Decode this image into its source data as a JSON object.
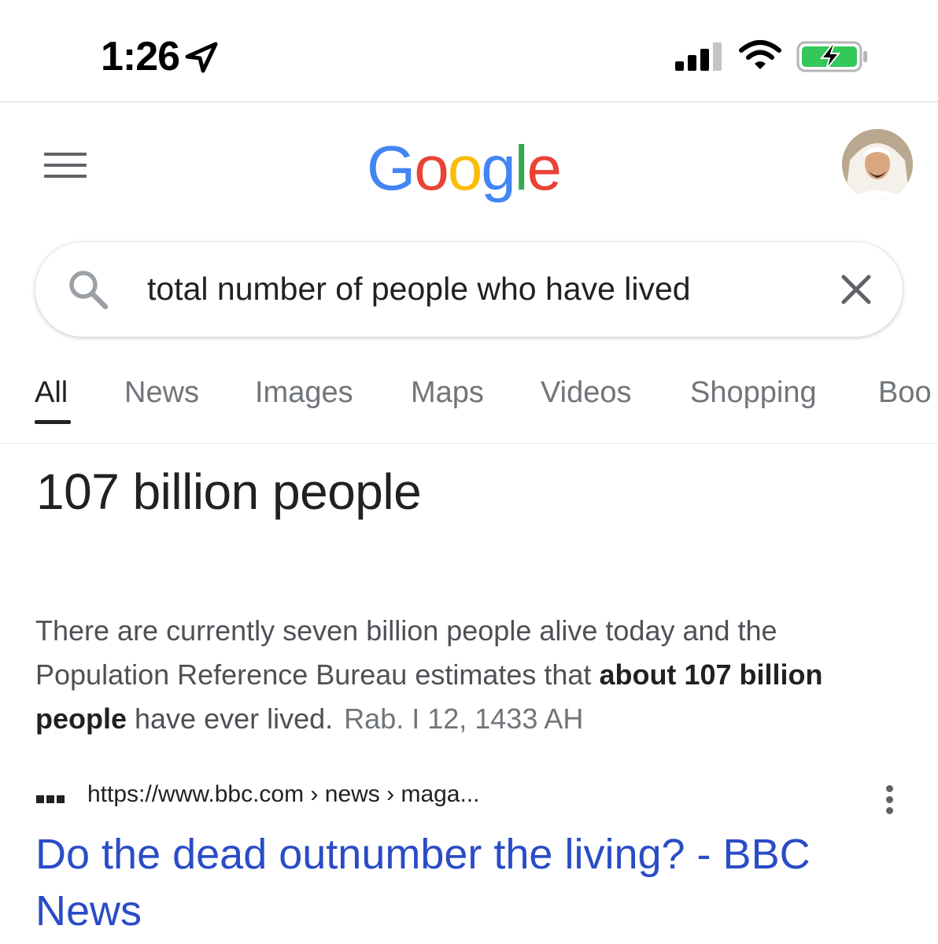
{
  "status_bar": {
    "time": "1:26",
    "icons": [
      "location-arrow-icon",
      "cellular-signal-icon",
      "wifi-icon",
      "battery-charging-icon"
    ],
    "battery_color": "#34C759"
  },
  "header": {
    "logo": {
      "letters": [
        "G",
        "o",
        "o",
        "g",
        "l",
        "e"
      ],
      "colors": [
        "#4285F4",
        "#EA4335",
        "#FBBC05",
        "#4285F4",
        "#34A853",
        "#EA4335"
      ]
    },
    "menu_icon": "hamburger-menu-icon",
    "avatar_icon": "user-avatar"
  },
  "search": {
    "query": "total number of people who have lived",
    "search_icon": "search-icon",
    "clear_icon": "close-icon"
  },
  "tabs": [
    {
      "label": "All",
      "active": true
    },
    {
      "label": "News",
      "active": false
    },
    {
      "label": "Images",
      "active": false
    },
    {
      "label": "Maps",
      "active": false
    },
    {
      "label": "Videos",
      "active": false
    },
    {
      "label": "Shopping",
      "active": false
    },
    {
      "label": "Boo",
      "active": false
    }
  ],
  "featured_snippet": {
    "answer": "107 billion people",
    "text_before": "There are currently seven billion people alive today and the Population Reference Bureau estimates that ",
    "text_bold": "about 107 billion people",
    "text_after": " have ever lived.",
    "date": "Rab. I 12, 1433 AH"
  },
  "result": {
    "url": "https://www.bbc.com › news › maga...",
    "title": "Do the dead outnumber the living? - BBC News"
  },
  "colors": {
    "link": "#2a4cc6",
    "text_primary": "#202124",
    "text_secondary": "#70757a"
  }
}
